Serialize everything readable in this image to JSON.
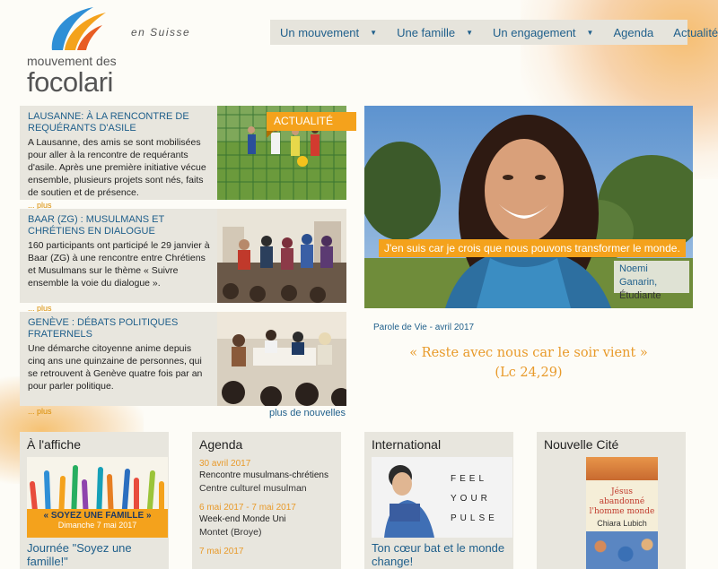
{
  "header": {
    "logo_line1": "mouvement des",
    "logo_line2": "focolari",
    "tagline": "en Suisse"
  },
  "nav": {
    "items": [
      {
        "label": "Un mouvement",
        "dropdown": true
      },
      {
        "label": "Une famille",
        "dropdown": true
      },
      {
        "label": "Un engagement",
        "dropdown": true
      },
      {
        "label": "Agenda",
        "dropdown": false
      },
      {
        "label": "Actualité",
        "dropdown": false
      }
    ]
  },
  "news": {
    "tag": "ACTUALITÉ",
    "more_label": "... plus",
    "items": [
      {
        "title": "LAUSANNE: À LA RENCONTRE DE REQUÉRANTS D'ASILE",
        "body": "A Lausanne, des amis se sont mobilisées pour aller à la rencontre de requérants d'asile. Après une première initiative vécue ensemble, plusieurs projets sont nés, faits de soutien et de présence."
      },
      {
        "title": "BAAR (ZG) : MUSULMANS ET CHRÉTIENS EN DIALOGUE",
        "body": "160 participants ont participé le 29 janvier à Baar (ZG) à une rencontre entre Chrétiens et Musulmans sur le thème « Suivre ensemble la voie du dialogue »."
      },
      {
        "title": "GENÈVE : DÉBATS POLITIQUES FRATERNELS",
        "body": "Une démarche citoyenne anime depuis cinq ans une quinzaine de personnes, qui se retrouvent à Genève quatre fois par an pour parler politique."
      }
    ],
    "more_news": "plus de nouvelles"
  },
  "hero": {
    "quote": "J'en suis car je crois que nous pouvons transformer le monde.",
    "author_name": "Noemi Ganarin,",
    "author_role": "Étudiante"
  },
  "parole": {
    "label": "Parole de Vie - avril 2017",
    "quote_line1": "« Reste avec nous car le soir vient »",
    "quote_line2": "(Lc 24,29)"
  },
  "boxes": {
    "affiche": {
      "title": "À l'affiche",
      "banner_text": "« SOYEZ UNE FAMILLE »",
      "banner_date": "Dimanche 7 mai 2017",
      "caption": "Journée \"Soyez une famille!\""
    },
    "agenda": {
      "title": "Agenda",
      "events": [
        {
          "date": "30 avril 2017",
          "name": "Rencontre musulmans-chrétiens",
          "place": "Centre culturel musulman"
        },
        {
          "date": "6 mai 2017 - 7 mai 2017",
          "name": "Week-end Monde Uni",
          "place": "Montet (Broye)"
        },
        {
          "date": "7 mai 2017",
          "name": "",
          "place": ""
        }
      ]
    },
    "international": {
      "title": "International",
      "poster_text": "FEEL YOUR PULSE",
      "caption": "Ton cœur bat et le monde change!"
    },
    "nouvelle_cite": {
      "title": "Nouvelle Cité",
      "book_title": "Jésus abandonné l'homme monde",
      "book_author": "Chiara Lubich"
    }
  },
  "colors": {
    "accent_orange": "#f4a21c",
    "link_blue": "#1f5f8b",
    "panel_bg": "#e8e6de"
  }
}
